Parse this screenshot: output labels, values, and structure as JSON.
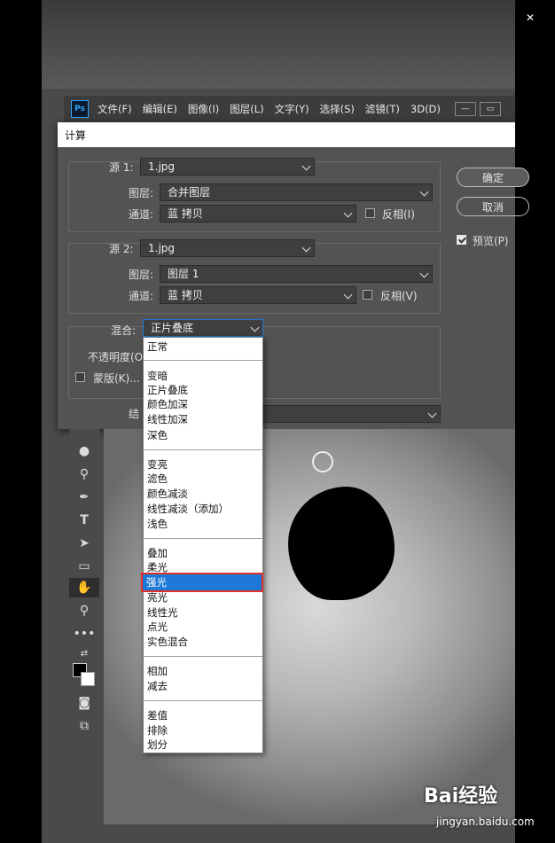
{
  "window_controls": {
    "minimize": "—",
    "maximize": "☐",
    "close": "✕"
  },
  "menu": {
    "logo": "Ps",
    "items": [
      "文件(F)",
      "编辑(E)",
      "图像(I)",
      "图层(L)",
      "文字(Y)",
      "选择(S)",
      "滤镜(T)",
      "3D(D)"
    ]
  },
  "dialog": {
    "title": "计算",
    "source1": {
      "label": "源 1:",
      "file": "1.jpg",
      "layer_label": "图层:",
      "layer": "合并图层",
      "channel_label": "通道:",
      "channel": "蓝 拷贝",
      "invert": "反相(I)"
    },
    "source2": {
      "label": "源 2:",
      "file": "1.jpg",
      "layer_label": "图层:",
      "layer": "图层 1",
      "channel_label": "通道:",
      "channel": "蓝 拷贝",
      "invert": "反相(V)"
    },
    "blend": {
      "label": "混合:",
      "value": "正片叠底",
      "opacity_label": "不透明度(O",
      "mask_label": "蒙版(K)..."
    },
    "result_label": "结",
    "ok": "确定",
    "cancel": "取消",
    "preview": "预览(P)"
  },
  "blend_options": {
    "group1": [
      "正常"
    ],
    "group2": [
      "变暗",
      "正片叠底",
      "颜色加深",
      "线性加深",
      "深色"
    ],
    "group3": [
      "变亮",
      "滤色",
      "颜色减淡",
      "线性减淡（添加）",
      "浅色"
    ],
    "group4": [
      "叠加",
      "柔光",
      "强光",
      "亮光",
      "线性光",
      "点光",
      "实色混合"
    ],
    "group5": [
      "相加",
      "减去"
    ],
    "group6": [
      "差值",
      "排除",
      "划分"
    ],
    "highlighted": "强光"
  },
  "watermark": {
    "brand": "Bai经验",
    "url": "jingyan.baidu.com"
  }
}
